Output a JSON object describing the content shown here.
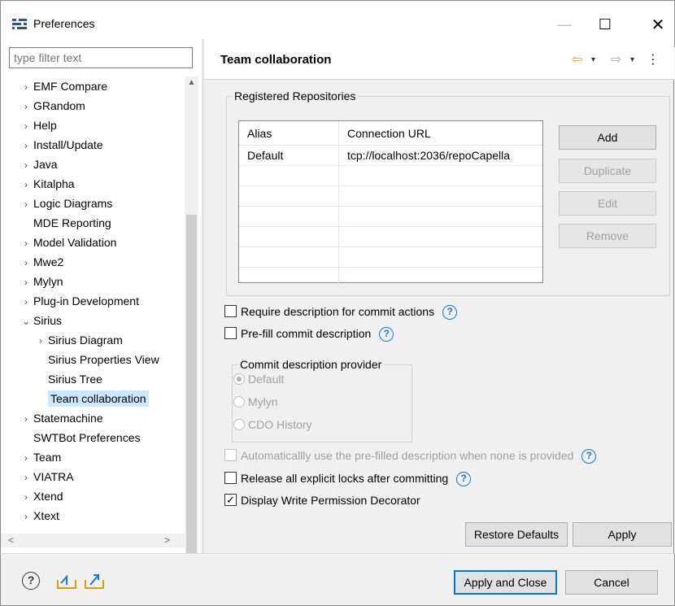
{
  "window": {
    "title": "Preferences",
    "minimize_glyph": "—",
    "maximize_glyph": "☐",
    "close_glyph": "✕"
  },
  "sidebar": {
    "filter_placeholder": "type filter text",
    "items": [
      {
        "label": "EMF Compare",
        "chevron": "›"
      },
      {
        "label": "GRandom",
        "chevron": "›"
      },
      {
        "label": "Help",
        "chevron": "›"
      },
      {
        "label": "Install/Update",
        "chevron": "›"
      },
      {
        "label": "Java",
        "chevron": "›"
      },
      {
        "label": "Kitalpha",
        "chevron": "›"
      },
      {
        "label": "Logic Diagrams",
        "chevron": "›"
      },
      {
        "label": "MDE Reporting",
        "chevron": ""
      },
      {
        "label": "Model Validation",
        "chevron": "›"
      },
      {
        "label": "Mwe2",
        "chevron": "›"
      },
      {
        "label": "Mylyn",
        "chevron": "›"
      },
      {
        "label": "Plug-in Development",
        "chevron": "›"
      },
      {
        "label": "Sirius",
        "chevron": "⌄"
      },
      {
        "label": "Sirius Diagram",
        "chevron": "›"
      },
      {
        "label": "Sirius Properties View",
        "chevron": ""
      },
      {
        "label": "Sirius Tree",
        "chevron": ""
      },
      {
        "label": "Team collaboration",
        "chevron": ""
      },
      {
        "label": "Statemachine",
        "chevron": "›"
      },
      {
        "label": "SWTBot Preferences",
        "chevron": ""
      },
      {
        "label": "Team",
        "chevron": "›"
      },
      {
        "label": "VIATRA",
        "chevron": "›"
      },
      {
        "label": "Xtend",
        "chevron": "›"
      },
      {
        "label": "Xtext",
        "chevron": "›"
      }
    ],
    "scroll_up": "▲",
    "scroll_down": "▼",
    "scroll_left": "<",
    "scroll_right": ">"
  },
  "page": {
    "title": "Team collaboration",
    "nav_back": "⇦",
    "nav_drop": "▾",
    "nav_forward": "⇨",
    "nav_menu": "⋮",
    "repos_group_label": "Registered Repositories",
    "table": {
      "headers": [
        "Alias",
        "Connection URL"
      ],
      "rows": [
        [
          "Default",
          "tcp://localhost:2036/repoCapella"
        ]
      ]
    },
    "buttons": {
      "add": "Add",
      "duplicate": "Duplicate",
      "edit": "Edit",
      "remove": "Remove"
    },
    "options": {
      "require_description": "Require description for commit actions",
      "prefill": "Pre-fill commit description",
      "auto_use": "Automaticallly use the pre-filled description when none is provided",
      "release_locks": "Release all explicit locks after committing",
      "write_permission": "Display Write Permission Decorator"
    },
    "provider_group_label": "Commit description provider",
    "providers": [
      "Default",
      "Mylyn",
      "CDO History"
    ],
    "help_glyph": "?",
    "restore_defaults": "Restore Defaults",
    "apply": "Apply"
  },
  "footer": {
    "help_glyph": "?",
    "apply_and_close": "Apply and Close",
    "cancel": "Cancel"
  },
  "colors": {
    "selection": "#cce8ff",
    "accent": "#0078d7",
    "help_blue": "#1976d2",
    "nav_yellow": "#d9a000"
  }
}
